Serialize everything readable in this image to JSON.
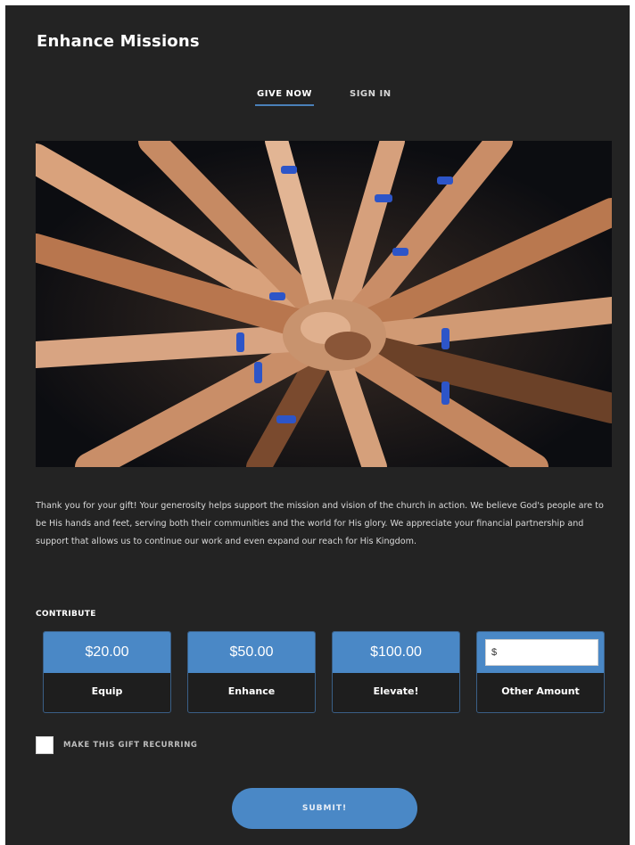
{
  "page": {
    "title": "Enhance Missions"
  },
  "tabs": [
    {
      "label": "GIVE NOW",
      "active": true
    },
    {
      "label": "SIGN IN",
      "active": false
    }
  ],
  "hero": {
    "icon": "hands-together-photo"
  },
  "description": "Thank you for your gift! Your generosity helps support the mission and vision of the church in action. We believe God's people are to be His hands and feet, serving both their communities and the world for His glory. We appreciate your financial partnership and support that allows us to continue our work and even expand our reach for His Kingdom.",
  "contribute": {
    "label": "CONTRIBUTE",
    "options": [
      {
        "amount": "$20.00",
        "name": "Equip"
      },
      {
        "amount": "$50.00",
        "name": "Enhance"
      },
      {
        "amount": "$100.00",
        "name": "Elevate!"
      }
    ],
    "other": {
      "name": "Other Amount",
      "value": "$",
      "placeholder": ""
    }
  },
  "recurring": {
    "label": "MAKE THIS GIFT RECURRING",
    "checked": false
  },
  "submit": {
    "label": "SUBMIT!"
  },
  "colors": {
    "background": "#232323",
    "accent": "#4a88c6",
    "text": "#ffffff"
  }
}
